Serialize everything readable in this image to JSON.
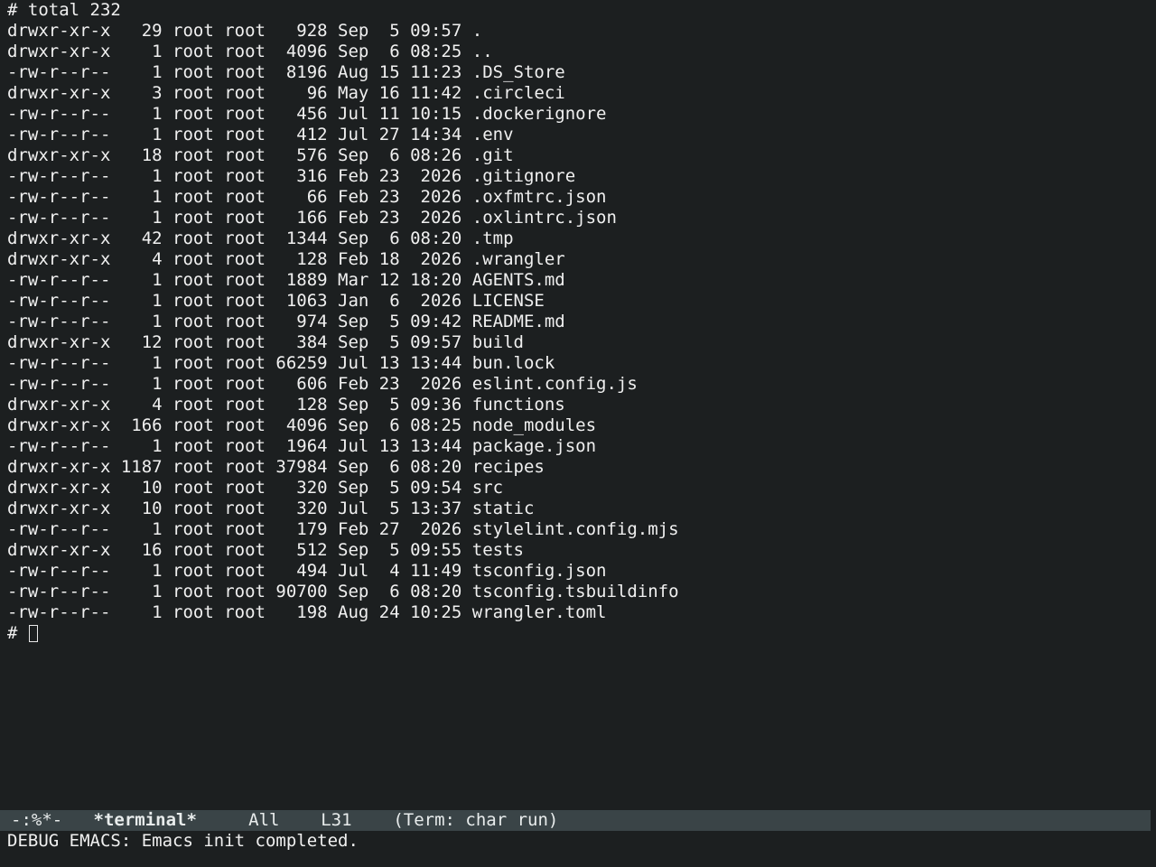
{
  "terminal": {
    "header": "# total 232",
    "rows": [
      "drwxr-xr-x   29 root root   928 Sep  5 09:57 .",
      "drwxr-xr-x    1 root root  4096 Sep  6 08:25 ..",
      "-rw-r--r--    1 root root  8196 Aug 15 11:23 .DS_Store",
      "drwxr-xr-x    3 root root    96 May 16 11:42 .circleci",
      "-rw-r--r--    1 root root   456 Jul 11 10:15 .dockerignore",
      "-rw-r--r--    1 root root   412 Jul 27 14:34 .env",
      "drwxr-xr-x   18 root root   576 Sep  6 08:26 .git",
      "-rw-r--r--    1 root root   316 Feb 23  2026 .gitignore",
      "-rw-r--r--    1 root root    66 Feb 23  2026 .oxfmtrc.json",
      "-rw-r--r--    1 root root   166 Feb 23  2026 .oxlintrc.json",
      "drwxr-xr-x   42 root root  1344 Sep  6 08:20 .tmp",
      "drwxr-xr-x    4 root root   128 Feb 18  2026 .wrangler",
      "-rw-r--r--    1 root root  1889 Mar 12 18:20 AGENTS.md",
      "-rw-r--r--    1 root root  1063 Jan  6  2026 LICENSE",
      "-rw-r--r--    1 root root   974 Sep  5 09:42 README.md",
      "drwxr-xr-x   12 root root   384 Sep  5 09:57 build",
      "-rw-r--r--    1 root root 66259 Jul 13 13:44 bun.lock",
      "-rw-r--r--    1 root root   606 Feb 23  2026 eslint.config.js",
      "drwxr-xr-x    4 root root   128 Sep  5 09:36 functions",
      "drwxr-xr-x  166 root root  4096 Sep  6 08:25 node_modules",
      "-rw-r--r--    1 root root  1964 Jul 13 13:44 package.json",
      "drwxr-xr-x 1187 root root 37984 Sep  6 08:20 recipes",
      "drwxr-xr-x   10 root root   320 Sep  5 09:54 src",
      "drwxr-xr-x   10 root root   320 Jul  5 13:37 static",
      "-rw-r--r--    1 root root   179 Feb 27  2026 stylelint.config.mjs",
      "drwxr-xr-x   16 root root   512 Sep  5 09:55 tests",
      "-rw-r--r--    1 root root   494 Jul  4 11:49 tsconfig.json",
      "-rw-r--r--    1 root root 90700 Sep  6 08:20 tsconfig.tsbuildinfo",
      "-rw-r--r--    1 root root   198 Aug 24 10:25 wrangler.toml"
    ],
    "prompt": "# "
  },
  "mode_line": {
    "status": "-:%*-",
    "buffer_name": "*terminal*",
    "position": "All",
    "line": "L31",
    "mode": "(Term: char run)"
  },
  "echo_area": {
    "message": "DEBUG EMACS: Emacs init completed."
  },
  "colors": {
    "background": "#1c1f20",
    "foreground": "#f0f0f0",
    "mode_line_bg": "#3a4447"
  }
}
